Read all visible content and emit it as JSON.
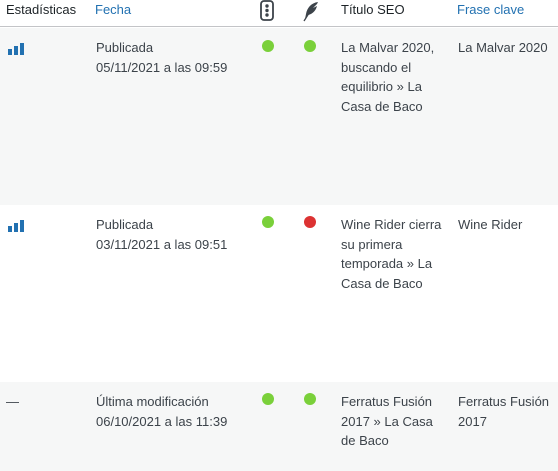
{
  "header": {
    "stats": "Estadísticas",
    "date": "Fecha",
    "readability_icon": "traffic-light-icon",
    "seo_icon": "feather-icon",
    "seo_title": "Título SEO",
    "keyphrase": "Frase clave"
  },
  "colors": {
    "link": "#2271b1",
    "good": "#7ad03a",
    "bad": "#dc3232",
    "row_alt": "#f6f7f7"
  },
  "rows": [
    {
      "stats": "bar-chart-icon",
      "status": "Publicada",
      "date": "05/11/2021 a las 09:59",
      "readability": "good",
      "seo": "good",
      "seo_title": "La Malvar 2020, buscando el equilibrio » La Casa de Baco",
      "keyphrase": "La Malvar 2020"
    },
    {
      "stats": "bar-chart-icon",
      "status": "Publicada",
      "date": "03/11/2021 a las 09:51",
      "readability": "good",
      "seo": "bad",
      "seo_title": "Wine Rider cierra su primera temporada » La Casa de Baco",
      "keyphrase": "Wine Rider"
    },
    {
      "stats": "—",
      "status": "Última modificación",
      "date": "06/10/2021 a las 11:39",
      "readability": "good",
      "seo": "good",
      "seo_title": "Ferratus Fusión 2017 » La Casa de Baco",
      "keyphrase": "Ferratus Fusión 2017"
    }
  ]
}
